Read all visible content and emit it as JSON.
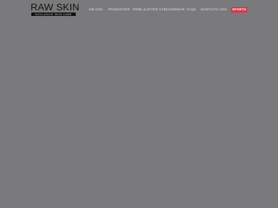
{
  "header": {
    "logo_text": "RAW SKIN",
    "logo_tagline": "EXCLUSIVE SKIN CARE"
  },
  "nav": {
    "items": [
      {
        "label": "OM OSS"
      },
      {
        "label": "PRODUKTER"
      },
      {
        "label": "FÖRE & EFTER"
      },
      {
        "label": "UTBILDNINGAR"
      },
      {
        "label": "FAQS"
      },
      {
        "label": "KONTAKTA OSS"
      },
      {
        "label": "SPORTS"
      }
    ]
  },
  "colors": {
    "background": "#7a7a7c",
    "logo": "#111111",
    "nav_text": "#e6e6e6",
    "badge": "#e0334c"
  }
}
